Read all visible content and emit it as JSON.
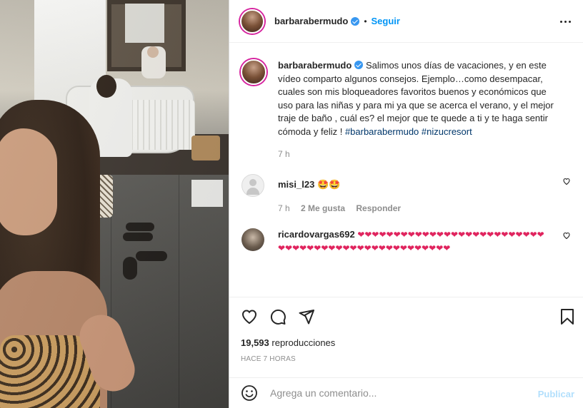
{
  "post": {
    "username": "barbarabermudo",
    "follow_label": "Seguir",
    "dot": "•",
    "caption": {
      "username": "barbarabermudo",
      "text": "Salimos unos días de vacaciones, y en este vídeo comparto algunos consejos. Ejemplo…como desempacar, cuales son mis bloqueadores favoritos buenos y económicos que uso para las niñas y para mi ya que se acerca el verano, y el mejor traje de baño , cuál es? el mejor que te quede a ti y te haga sentir cómoda y feliz ! ",
      "hashtag1": "#barbarabermudo",
      "hashtag2": "#nizucresort",
      "time": "7 h"
    },
    "comments": [
      {
        "username": "misi_l23",
        "text": "🤩🤩",
        "time": "7 h",
        "likes": "2 Me gusta",
        "reply": "Responder"
      },
      {
        "username": "ricardovargas692",
        "text": "❤❤❤❤❤❤❤❤❤❤❤❤❤❤❤❤❤❤❤❤❤❤❤❤❤❤❤❤❤❤❤❤❤❤❤❤❤❤❤❤❤❤❤❤❤❤❤❤❤❤"
      }
    ],
    "views_count": "19,593",
    "views_label": "reproducciones",
    "ago": "HACE 7 HORAS",
    "add_comment_placeholder": "Agrega un comentario...",
    "publish_label": "Publicar"
  },
  "icons": {
    "more": "more-options-icon",
    "like": "heart-icon",
    "comment": "comment-icon",
    "share": "share-icon",
    "save": "bookmark-icon",
    "emoji": "smiley-icon"
  },
  "colors": {
    "accent": "#0095f6",
    "verified": "#3897f0",
    "hashtag": "#00376b",
    "muted": "#8e8e8e",
    "publish_disabled": "#b2dffc",
    "heart": "#e0245e"
  }
}
